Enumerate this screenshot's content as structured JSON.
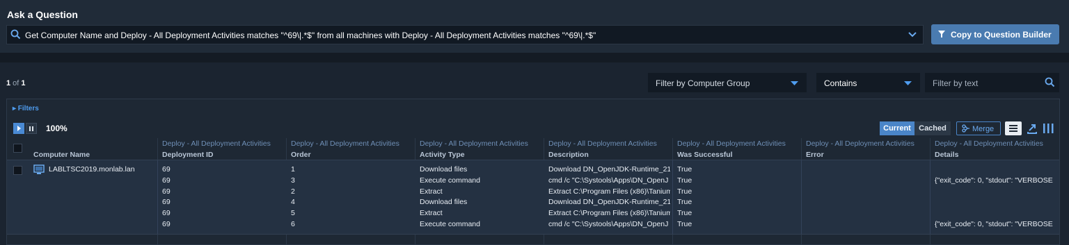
{
  "ask": {
    "title": "Ask a Question",
    "question": "Get Computer Name and Deploy - All Deployment Activities matches \"^69\\|.*$\" from all machines with Deploy - All Deployment Activities matches \"^69\\|.*$\"",
    "copy_button": "Copy to Question Builder"
  },
  "toolbar": {
    "page_current": "1",
    "page_of": " of ",
    "page_total": "1",
    "computer_group_placeholder": "Filter by Computer Group",
    "match_mode": "Contains",
    "filter_text_placeholder": "Filter by text"
  },
  "grid": {
    "filters_label": "▸ Filters",
    "percent": "100%",
    "current_label": "Current",
    "cached_label": "Cached",
    "merge_label": "Merge",
    "columns": [
      {
        "sensor": "",
        "name": "Computer Name"
      },
      {
        "sensor": "Deploy - All Deployment Activities",
        "name": "Deployment ID"
      },
      {
        "sensor": "Deploy - All Deployment Activities",
        "name": "Order"
      },
      {
        "sensor": "Deploy - All Deployment Activities",
        "name": "Activity Type"
      },
      {
        "sensor": "Deploy - All Deployment Activities",
        "name": "Description"
      },
      {
        "sensor": "Deploy - All Deployment Activities",
        "name": "Was Successful"
      },
      {
        "sensor": "Deploy - All Deployment Activities",
        "name": "Error"
      },
      {
        "sensor": "Deploy - All Deployment Activities",
        "name": "Details"
      }
    ],
    "row": {
      "computer_name": "LABLTSC2019.monlab.lan",
      "deployment_id": [
        "69",
        "69",
        "69",
        "69",
        "69",
        "69"
      ],
      "order": [
        "1",
        "3",
        "2",
        "4",
        "5",
        "6"
      ],
      "activity_type": [
        "Download files",
        "Execute command",
        "Extract",
        "Download files",
        "Extract",
        "Execute command"
      ],
      "description": [
        "Download DN_OpenJDK-Runtime_21",
        "cmd /c \"C:\\Systools\\Apps\\DN_OpenJ",
        "Extract C:\\Program Files (x86)\\Tanium",
        "Download DN_OpenJDK-Runtime_21",
        "Extract C:\\Program Files (x86)\\Tanium",
        "cmd /c \"C:\\Systools\\Apps\\DN_OpenJ"
      ],
      "was_successful": [
        "True",
        "True",
        "True",
        "True",
        "True",
        "True"
      ],
      "error": [
        "",
        "",
        "",
        "",
        "",
        ""
      ],
      "details": [
        "",
        "{\"exit_code\": 0, \"stdout\": \"VERBOSE",
        "",
        "",
        "",
        "{\"exit_code\": 0, \"stdout\": \"VERBOSE"
      ]
    }
  },
  "colors": {
    "accent": "#4a85c8",
    "link": "#4f9df0",
    "background": "#1b2430"
  }
}
